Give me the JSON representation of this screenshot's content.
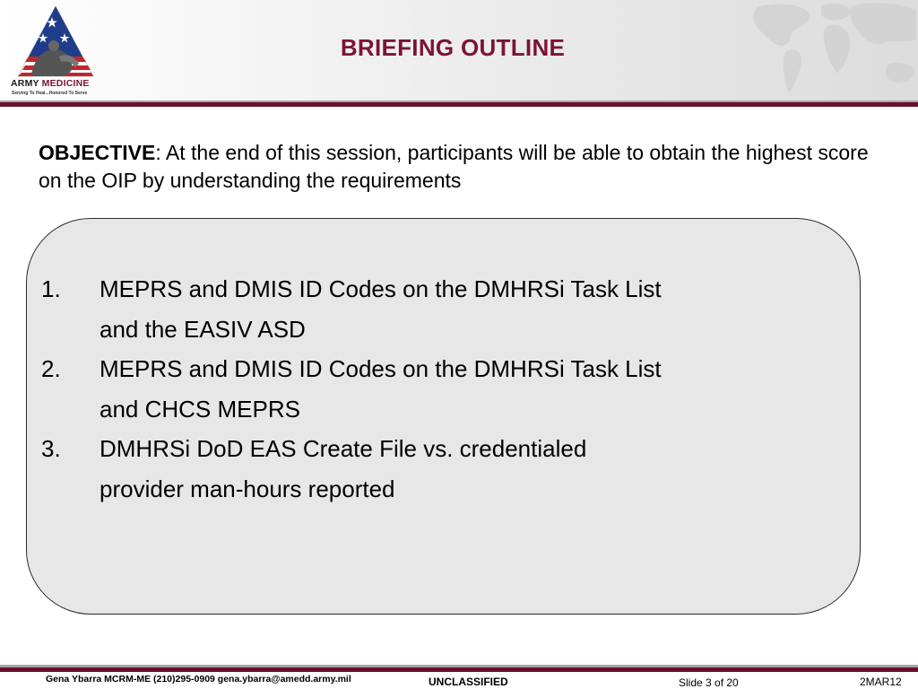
{
  "header": {
    "title": "BRIEFING OUTLINE",
    "logo": {
      "text_army": "ARMY",
      "text_medicine": "MEDICINE",
      "tagline": "Serving To Heal...Honored To Serve"
    }
  },
  "objective": {
    "label": "OBJECTIVE",
    "text": ":  At the end of this session, participants will be able to obtain the highest score on the OIP by understanding the requirements"
  },
  "outline": {
    "items": [
      {
        "number": "1.",
        "text": "MEPRS and DMIS ID Codes on the DMHRSi Task List and the EASIV ASD"
      },
      {
        "number": "2.",
        "text": "MEPRS and DMIS ID Codes on the DMHRSi Task List and CHCS MEPRS"
      },
      {
        "number": "3.",
        "text": "DMHRSi DoD EAS Create File vs. credentialed provider man-hours reported"
      }
    ]
  },
  "footer": {
    "contact": "Gena Ybarra MCRM-ME (210)295-0909 gena.ybarra@amedd.army.mil",
    "classification": "UNCLASSIFIED",
    "slide": "Slide 3 of 20",
    "date": "2MAR12"
  },
  "colors": {
    "accent": "#7b1434",
    "rule": "#6b0f2c",
    "box_fill": "#e7e7e7",
    "flag_blue": "#1f3d8a",
    "flag_red": "#c0272d"
  }
}
